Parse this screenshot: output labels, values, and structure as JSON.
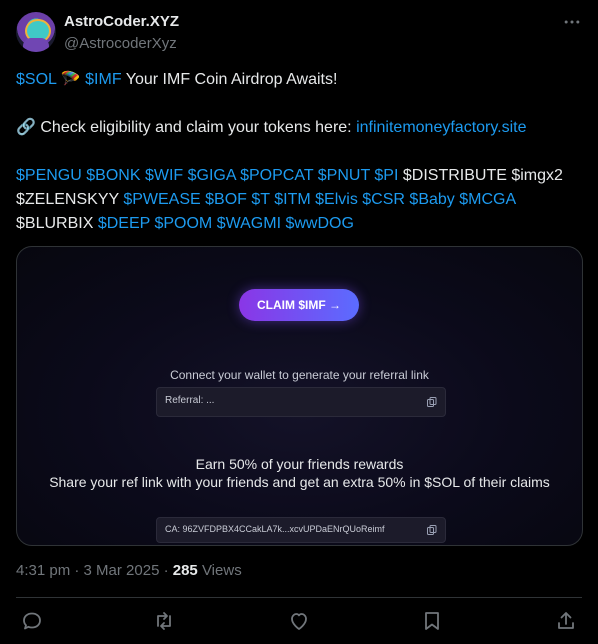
{
  "author": {
    "name": "AstroCoder.XYZ",
    "handle": "@AstrocoderXyz"
  },
  "tweet": {
    "line1": {
      "tag1": "$SOL",
      "emoji": "🪂",
      "tag2": "$IMF",
      "text": " Your IMF Coin Airdrop Awaits!"
    },
    "line2": {
      "emoji": "🔗",
      "text": " Check eligibility and claim your tokens here: ",
      "link": "infinitemoneyfactory.site"
    },
    "tags_row1": [
      "$PENGU",
      "$BONK",
      "$WIF",
      "$GIGA",
      "$POPCAT",
      "$PNUT",
      "$PI"
    ],
    "row1_plain": "$DISTRIBUTE $imgx2",
    "row2_plain": "$ZELENSKYY",
    "tags_row2": [
      "$PWEASE",
      "$BOF",
      "$T",
      "$ITM",
      "$Elvis",
      "$CSR",
      "$Baby",
      "$MCGA"
    ],
    "row3_plain": "$BLURBIX",
    "tags_row3": [
      "$DEEP",
      "$POOM",
      "$WAGMI",
      "$wwDOG"
    ]
  },
  "card": {
    "claim_button": "CLAIM $IMF →",
    "connect_text": "Connect your wallet to generate your referral link",
    "referral_label": "Referral: ...",
    "earn_line1": "Earn 50% of your friends rewards",
    "earn_line2": "Share your ref link with your friends and get an extra 50% in $SOL of their claims",
    "ca_label": "CA: 96ZVFDPBX4CCakLA7k...xcvUPDaENrQUoReimf"
  },
  "meta": {
    "time": "4:31 pm · 3 Mar 2025 · ",
    "views_count": "285",
    "views_label": " Views"
  },
  "icons": [
    "reply-icon",
    "retweet-icon",
    "like-icon",
    "bookmark-icon",
    "share-icon"
  ],
  "colors": {
    "link": "#1d9bf0",
    "background": "#000000",
    "muted": "#71767b"
  }
}
